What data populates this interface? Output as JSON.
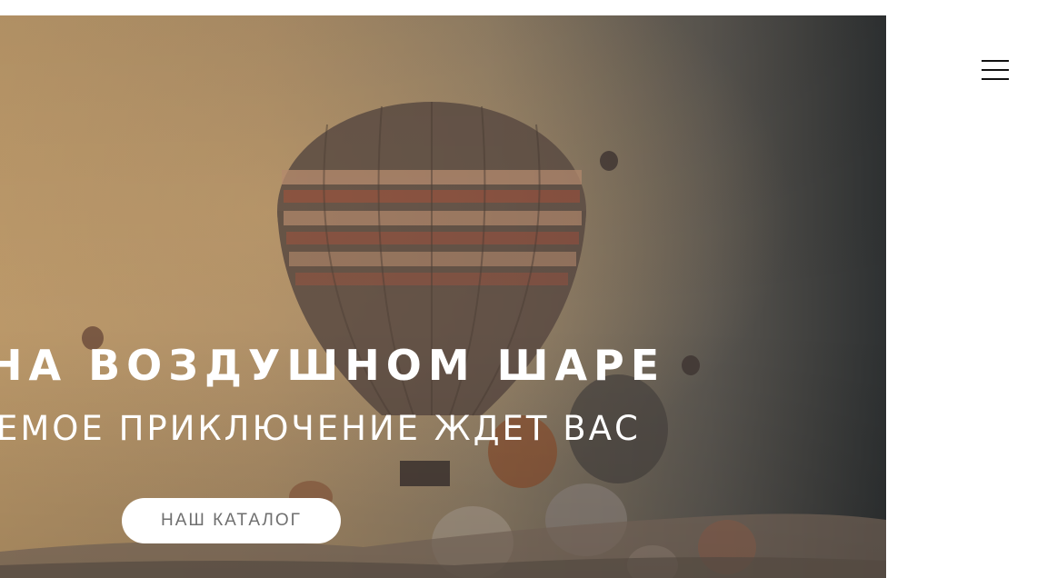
{
  "header": {
    "menu_icon": "hamburger-menu-icon"
  },
  "hero": {
    "background_image": "hot-air-balloons-photo",
    "title": "НА ВОЗДУШНОМ ШАРЕ",
    "subtitle": "ЕМОЕ ПРИКЛЮЧЕНИЕ ЖДЕТ ВАС",
    "button_label": "НАШ КАТАЛОГ"
  },
  "colors": {
    "background": "#ffffff",
    "hero_text": "#ffffff",
    "button_background": "#ffffff",
    "button_text": "#6f6f6f",
    "menu_icon": "#111111"
  }
}
